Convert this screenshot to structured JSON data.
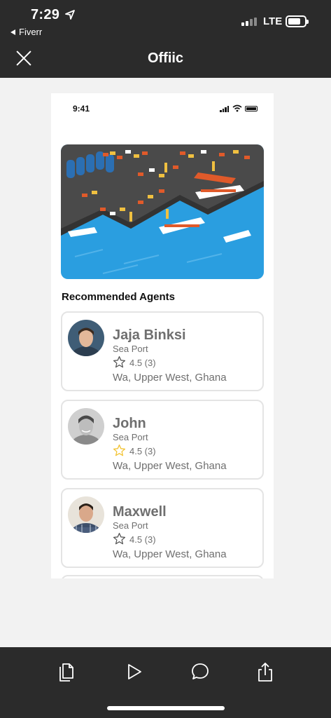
{
  "status_bar": {
    "time": "7:29",
    "back_app": "Fiverr",
    "network": "LTE"
  },
  "nav": {
    "title": "Offiic"
  },
  "screen": {
    "status_time": "9:41",
    "section_title": "Recommended Agents",
    "agents": [
      {
        "name": "Jaja Binksi",
        "type": "Sea Port",
        "rating": "4.5 (3)",
        "location": "Wa, Upper West, Ghana",
        "star_color": "#555555"
      },
      {
        "name": "John",
        "type": "Sea Port",
        "rating": "4.5 (3)",
        "location": "Wa, Upper West, Ghana",
        "star_color": "#f2c230"
      },
      {
        "name": "Maxwell",
        "type": "Sea Port",
        "rating": "4.5 (3)",
        "location": "Wa, Upper West, Ghana",
        "star_color": "#555555"
      }
    ]
  },
  "toolbar": {
    "icons": [
      "copy-icon",
      "play-icon",
      "comment-icon",
      "share-icon"
    ]
  },
  "colors": {
    "dark_bar": "#2b2b2b",
    "water": "#2a9ee0",
    "text_gray": "#6f6f6f"
  }
}
